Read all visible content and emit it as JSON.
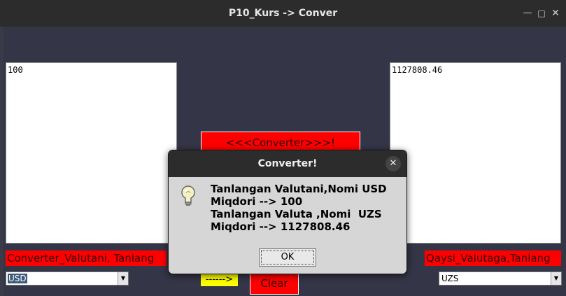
{
  "window": {
    "title": "P10_Kurs -> Conver"
  },
  "left_panel": {
    "input_value": "100",
    "label": "Converter_Valutani, Tanlang",
    "combo_value": "USD"
  },
  "right_panel": {
    "output_value": "1127808.46",
    "label": "Qaysi_Valutaga,Tanlang",
    "combo_value": "UZS"
  },
  "center": {
    "converter_button": "<<<Converter>>>!",
    "arrow_label": "------>",
    "clear_button": "Clear"
  },
  "dialog": {
    "title": "Converter!",
    "message_lines": [
      "Tanlangan Valutani,Nomi USD",
      "Miqdori --> 100",
      "Tanlangan Valuta ,Nomi  UZS",
      "Miqdori --> 1127808.46"
    ],
    "ok_label": "OK",
    "icon": "lightbulb-icon"
  }
}
